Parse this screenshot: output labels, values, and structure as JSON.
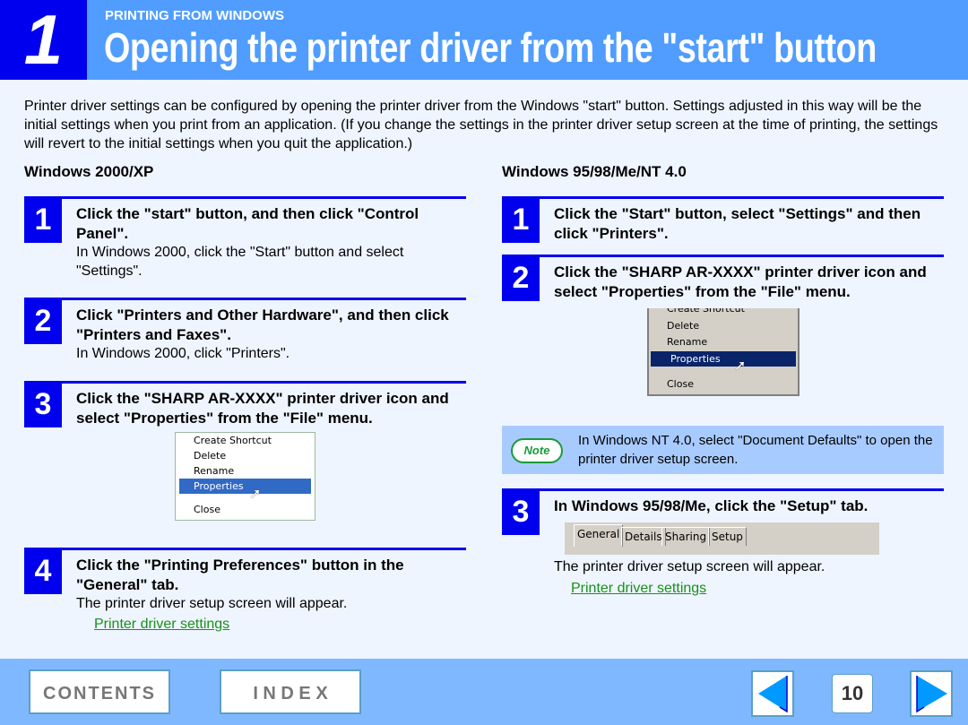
{
  "header": {
    "chapter_number": "1",
    "section": "PRINTING FROM WINDOWS",
    "title": "Opening the printer driver from the \"start\" button"
  },
  "intro": "Printer driver settings can be configured by opening the printer driver from the Windows \"start\" button. Settings adjusted in this way will be the initial settings when you print from an application. (If you change the settings in the printer driver setup screen at the time of printing, the settings will revert to the initial settings when you quit the application.)",
  "left": {
    "heading": "Windows 2000/XP",
    "steps": [
      {
        "num": "1",
        "head": "Click the \"start\" button, and then click \"Control Panel\".",
        "sub": "In Windows 2000, click the \"Start\" button and select \"Settings\"."
      },
      {
        "num": "2",
        "head": "Click \"Printers and Other Hardware\", and then click \"Printers and Faxes\".",
        "sub": "In Windows 2000, click \"Printers\"."
      },
      {
        "num": "3",
        "head": "Click the \"SHARP AR-XXXX\" printer driver icon and select \"Properties\" from the \"File\" menu."
      },
      {
        "num": "4",
        "head": "Click the \"Printing Preferences\" button in the \"General\" tab.",
        "sub": "The printer driver setup screen will appear.",
        "link": "Printer driver settings"
      }
    ],
    "menu": [
      "Create Shortcut",
      "Delete",
      "Rename",
      "Properties",
      "Close"
    ]
  },
  "right": {
    "heading": "Windows 95/98/Me/NT 4.0",
    "steps": [
      {
        "num": "1",
        "head": "Click the \"Start\" button, select \"Settings\" and then click \"Printers\"."
      },
      {
        "num": "2",
        "head": "Click the \"SHARP AR-XXXX\" printer driver icon and select \"Properties\" from the \"File\" menu."
      },
      {
        "num": "3",
        "head": "In Windows 95/98/Me, click the \"Setup\" tab.",
        "sub": "The printer driver setup screen will appear.",
        "link": "Printer driver settings"
      }
    ],
    "menu": [
      "Create Shortcut",
      "Delete",
      "Rename",
      "Properties",
      "Close"
    ],
    "note_label": "Note",
    "note": "In Windows NT 4.0, select \"Document Defaults\" to open the printer driver setup screen.",
    "tabs": [
      "General",
      "Details",
      "Sharing",
      "Setup"
    ]
  },
  "footer": {
    "contents": "CONTENTS",
    "index": "I N D E X",
    "page": "10"
  },
  "colors": {
    "header": "#519dff",
    "number_box": "#0000ee",
    "footer": "#80b8ff",
    "link": "#1a8f1a"
  }
}
